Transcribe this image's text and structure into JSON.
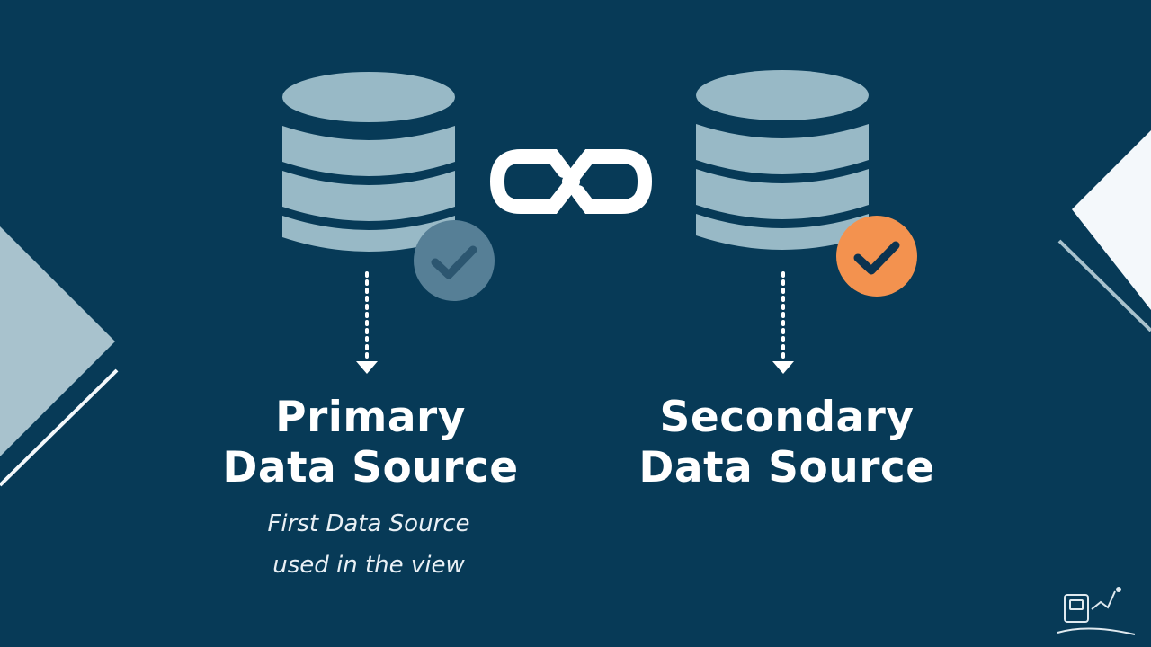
{
  "colors": {
    "background": "#073a57",
    "database": "#98b9c6",
    "check_primary": "#567f96",
    "check_secondary": "#f3924f",
    "link": "#ffffff",
    "arrow": "#ffffff",
    "decor_light": "#a8c2cd",
    "decor_white": "#f4f8fb"
  },
  "icons": {
    "primary_database": "database-icon",
    "secondary_database": "database-icon",
    "primary_check": "check-circle-icon",
    "secondary_check": "check-circle-icon",
    "link": "chain-link-icon",
    "arrow": "dotted-arrow-down-icon",
    "logo": "logo-icon"
  },
  "primary": {
    "title_line1": "Primary",
    "title_line2": "Data Source",
    "subtitle_line1": "First Data Source",
    "subtitle_line2": "used in the view"
  },
  "secondary": {
    "title_line1": "Secondary",
    "title_line2": "Data Source"
  }
}
